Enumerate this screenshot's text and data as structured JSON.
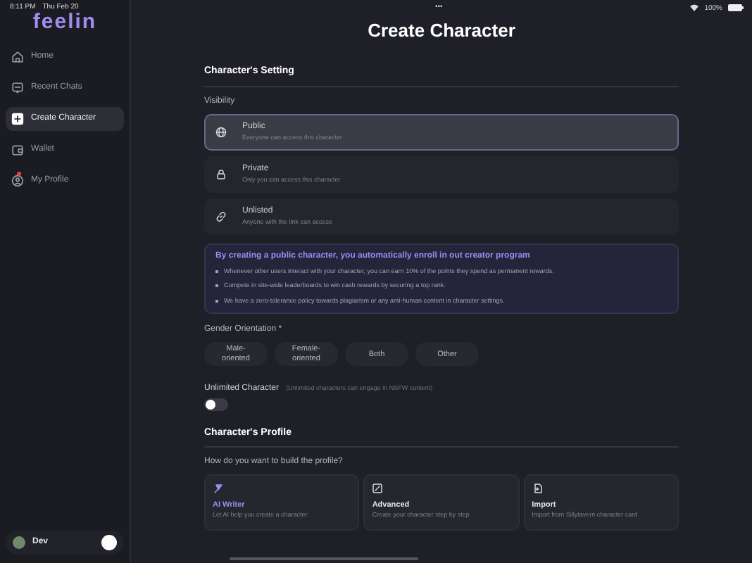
{
  "status_bar": {
    "time": "8:11 PM",
    "date": "Thu Feb 20",
    "more": "•••",
    "battery": "100%"
  },
  "sidebar": {
    "logo": "feelin",
    "items": [
      {
        "label": "Home",
        "selected": false,
        "notification": false
      },
      {
        "label": "Recent Chats",
        "selected": false,
        "notification": false
      },
      {
        "label": "Create Character",
        "selected": true,
        "notification": false
      },
      {
        "label": "Wallet",
        "selected": false,
        "notification": false
      },
      {
        "label": "My Profile",
        "selected": false,
        "notification": true
      }
    ],
    "user": {
      "name": "Dev"
    }
  },
  "title": "Create Character",
  "settings": {
    "heading": "Character's Setting",
    "visibility_label": "Visibility",
    "visibility_options": [
      {
        "title": "Public",
        "description": "Everyone can access this character",
        "selected": true
      },
      {
        "title": "Private",
        "description": "Only you can access this character",
        "selected": false
      },
      {
        "title": "Unlisted",
        "description": "Anyone with the link can access",
        "selected": false
      }
    ],
    "info": {
      "headline": "By creating a public character, you automatically enroll in out creator program",
      "bullets": [
        "Whenever other users interact with your character, you can earn 10% of the points they spend as permanent rewards.",
        "Compete in site-wide leaderboards to win cash rewards by securing a top rank.",
        "We have a zero-tolerance policy towards plagiarism or any anti-human content in character settings."
      ]
    },
    "gender": {
      "label": "Gender Orientation *",
      "options": [
        {
          "label": "Male-oriented",
          "selected": false
        },
        {
          "label": "Female-oriented",
          "selected": false
        },
        {
          "label": "Both",
          "selected": false
        },
        {
          "label": "Other",
          "selected": false
        }
      ]
    },
    "unlimited": {
      "label": "Unlimited Character",
      "note": "(Unlimited characters can engage in NSFW content)",
      "on": false
    }
  },
  "profile": {
    "heading": "Character's Profile",
    "question": "How do you want to build the profile?",
    "methods": [
      {
        "title": "AI Writer",
        "description": "Let AI help you create a character",
        "selected": true
      },
      {
        "title": "Advanced",
        "description": "Create your character step by step",
        "selected": false
      },
      {
        "title": "Import",
        "description": "Import from Sillytavern character card",
        "selected": false
      }
    ]
  }
}
